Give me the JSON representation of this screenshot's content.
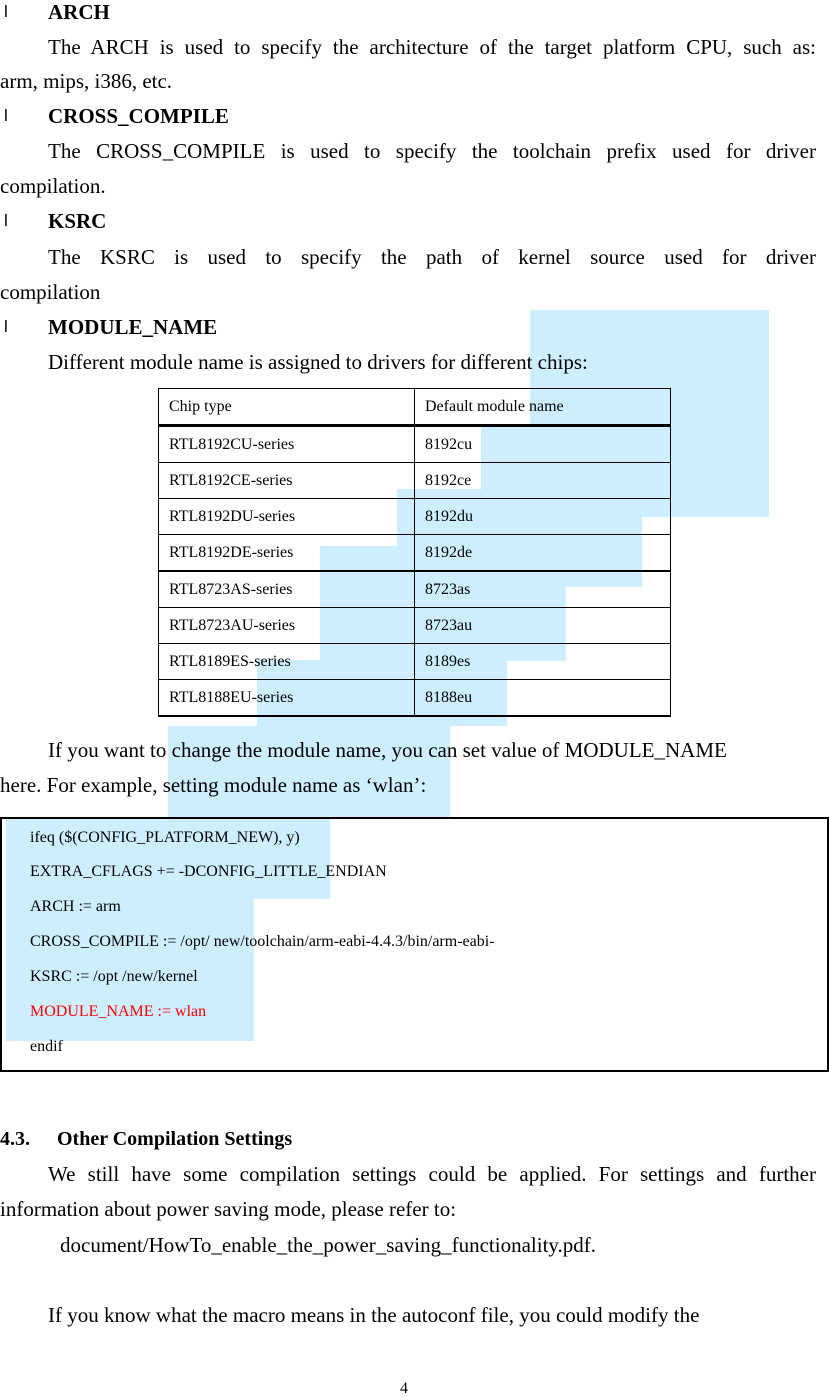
{
  "sections": [
    {
      "bullet": "l",
      "title": "ARCH",
      "body_line1": "The ARCH is used to specify the architecture of the target platform CPU, such as:",
      "body_line2": "arm, mips, i386, etc."
    },
    {
      "bullet": "l",
      "title": "CROSS_COMPILE",
      "body_line1": "The CROSS_COMPILE  is  used to specify  the toolchain  prefix  used for  driver",
      "body_line2": "compilation."
    },
    {
      "bullet": "l",
      "title": "KSRC",
      "body_line1": "The KSRC is used to specify the path of kernel source used for driver",
      "body_line2": "compilation"
    },
    {
      "bullet": "l",
      "title": "MODULE_NAME",
      "body_line1": "Different module name is assigned to drivers for different chips:"
    }
  ],
  "module_table": {
    "headers": [
      "Chip type",
      "Default module name"
    ],
    "rows": [
      [
        "RTL8192CU-series",
        "8192cu"
      ],
      [
        "RTL8192CE-series",
        "8192ce"
      ],
      [
        "RTL8192DU-series",
        "8192du"
      ],
      [
        "RTL8192DE-series",
        "8192de"
      ],
      [
        "RTL8723AS-series",
        "8723as"
      ],
      [
        "RTL8723AU-series",
        "8723au"
      ],
      [
        "RTL8189ES-series",
        "8189es"
      ],
      [
        "RTL8188EU-series",
        "8188eu"
      ]
    ]
  },
  "change_note": {
    "line1": "If you want to change the module name, you can set value of MODULE_NAME",
    "line2": "here. For example, setting module name as ‘wlan’:"
  },
  "code_block": {
    "lines": [
      {
        "text": "ifeq ($(CONFIG_PLATFORM_NEW), y)",
        "highlight": false
      },
      {
        "text": "EXTRA_CFLAGS += -DCONFIG_LITTLE_ENDIAN",
        "highlight": false
      },
      {
        "text": "ARCH := arm",
        "highlight": false
      },
      {
        "text": "CROSS_COMPILE := /opt/ new/toolchain/arm-eabi-4.4.3/bin/arm-eabi-",
        "highlight": false
      },
      {
        "text": "KSRC := /opt /new/kernel",
        "highlight": false
      },
      {
        "text": "MODULE_NAME := wlan",
        "highlight": true
      },
      {
        "text": "endif",
        "highlight": false
      }
    ],
    "highlight_color": "#ff0000"
  },
  "section_4_3": {
    "number": "4.3.",
    "title": "Other Compilation Settings",
    "para_line1": "We still have some compilation settings could be applied. For settings and further",
    "para_line2": "information about power saving mode, please refer to:",
    "reference": "document/HowTo_enable_the_power_saving_functionality.pdf.",
    "para2_line1": "If you know what the macro means in the autoconf file, you could modify the"
  },
  "selection_color": "#cceeff",
  "page_number": "4"
}
